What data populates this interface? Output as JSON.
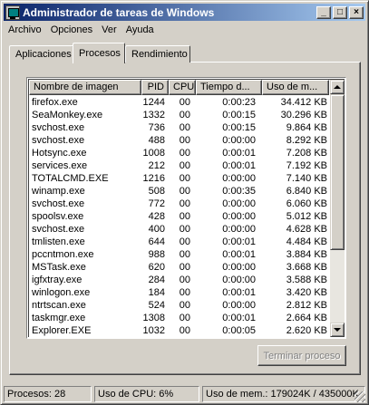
{
  "window": {
    "title": "Administrador de tareas de Windows"
  },
  "title_buttons": {
    "minimize": "_",
    "maximize": "□",
    "close": "×"
  },
  "menu": [
    "Archivo",
    "Opciones",
    "Ver",
    "Ayuda"
  ],
  "tabs": [
    "Aplicaciones",
    "Procesos",
    "Rendimiento"
  ],
  "active_tab": "Procesos",
  "table": {
    "columns": [
      "Nombre de imagen",
      "PID",
      "CPU",
      "Tiempo d...",
      "Uso de m..."
    ],
    "rows": [
      [
        "firefox.exe",
        "1244",
        "00",
        "0:00:23",
        "34.412 KB"
      ],
      [
        "SeaMonkey.exe",
        "1332",
        "00",
        "0:00:15",
        "30.296 KB"
      ],
      [
        "svchost.exe",
        "736",
        "00",
        "0:00:15",
        "9.864 KB"
      ],
      [
        "svchost.exe",
        "488",
        "00",
        "0:00:00",
        "8.292 KB"
      ],
      [
        "Hotsync.exe",
        "1008",
        "00",
        "0:00:01",
        "7.208 KB"
      ],
      [
        "services.exe",
        "212",
        "00",
        "0:00:01",
        "7.192 KB"
      ],
      [
        "TOTALCMD.EXE",
        "1216",
        "00",
        "0:00:00",
        "7.140 KB"
      ],
      [
        "winamp.exe",
        "508",
        "00",
        "0:00:35",
        "6.840 KB"
      ],
      [
        "svchost.exe",
        "772",
        "00",
        "0:00:00",
        "6.060 KB"
      ],
      [
        "spoolsv.exe",
        "428",
        "00",
        "0:00:00",
        "5.012 KB"
      ],
      [
        "svchost.exe",
        "400",
        "00",
        "0:00:00",
        "4.628 KB"
      ],
      [
        "tmlisten.exe",
        "644",
        "00",
        "0:00:01",
        "4.484 KB"
      ],
      [
        "pccntmon.exe",
        "988",
        "00",
        "0:00:01",
        "3.884 KB"
      ],
      [
        "MSTask.exe",
        "620",
        "00",
        "0:00:00",
        "3.668 KB"
      ],
      [
        "igfxtray.exe",
        "284",
        "00",
        "0:00:00",
        "3.588 KB"
      ],
      [
        "winlogon.exe",
        "184",
        "00",
        "0:00:01",
        "3.420 KB"
      ],
      [
        "ntrtscan.exe",
        "524",
        "00",
        "0:00:00",
        "2.812 KB"
      ],
      [
        "taskmgr.exe",
        "1308",
        "00",
        "0:00:01",
        "2.664 KB"
      ],
      [
        "Explorer.EXE",
        "1032",
        "00",
        "0:00:05",
        "2.620 KB"
      ]
    ]
  },
  "end_process_button": "Terminar proceso",
  "status": {
    "processes": "Procesos: 28",
    "cpu": "Uso de CPU: 6%",
    "memory": "Uso de mem.: 179024K / 435000K"
  }
}
